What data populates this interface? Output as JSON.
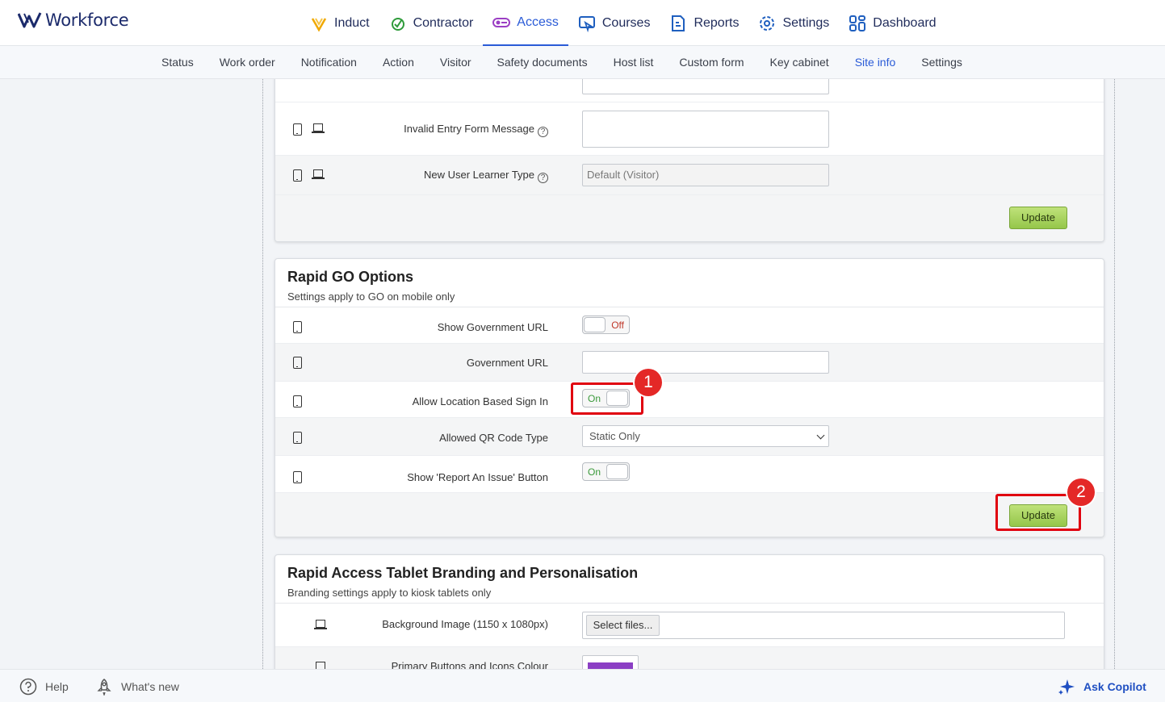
{
  "brand": {
    "name": "Workforce"
  },
  "top_nav": [
    {
      "label": "Induct",
      "icon": "induct-icon",
      "active": false
    },
    {
      "label": "Contractor",
      "icon": "contractor-icon",
      "active": false
    },
    {
      "label": "Access",
      "icon": "access-icon",
      "active": true
    },
    {
      "label": "Courses",
      "icon": "courses-icon",
      "active": false
    },
    {
      "label": "Reports",
      "icon": "reports-icon",
      "active": false
    },
    {
      "label": "Settings",
      "icon": "settings-icon",
      "active": false
    },
    {
      "label": "Dashboard",
      "icon": "dashboard-icon",
      "active": false
    }
  ],
  "sub_nav": [
    {
      "label": "Status"
    },
    {
      "label": "Work order"
    },
    {
      "label": "Notification"
    },
    {
      "label": "Action"
    },
    {
      "label": "Visitor"
    },
    {
      "label": "Safety documents"
    },
    {
      "label": "Host list"
    },
    {
      "label": "Custom form"
    },
    {
      "label": "Key cabinet"
    },
    {
      "label": "Site info",
      "active": true
    },
    {
      "label": "Settings"
    }
  ],
  "card1": {
    "rows": [
      {
        "label": "Invalid Entry Form Message",
        "value": ""
      },
      {
        "label": "New User Learner Type",
        "value": "Default (Visitor)"
      }
    ],
    "update_label": "Update"
  },
  "card2": {
    "title": "Rapid GO Options",
    "subtitle": "Settings apply to GO on mobile only",
    "rows": [
      {
        "label": "Show Government URL",
        "toggle": "Off"
      },
      {
        "label": "Government URL",
        "value": ""
      },
      {
        "label": "Allow Location Based Sign In",
        "toggle": "On"
      },
      {
        "label": "Allowed QR Code Type",
        "value": "Static Only"
      },
      {
        "label": "Show 'Report An Issue' Button",
        "toggle": "On"
      }
    ],
    "update_label": "Update"
  },
  "card3": {
    "title": "Rapid Access Tablet Branding and Personalisation",
    "subtitle": "Branding settings apply to kiosk tablets only",
    "rows": [
      {
        "label": "Background Image (1150 x 1080px)",
        "button": "Select files..."
      },
      {
        "label": "Primary Buttons and Icons Colour",
        "color": "#8b3fc4"
      }
    ]
  },
  "annotations": [
    "1",
    "2"
  ],
  "colors": {
    "accent": "#2a5bd7",
    "highlight": "#e0000f",
    "update_button": "#a8d45a"
  },
  "footer": {
    "help": "Help",
    "whats_new": "What's new",
    "copilot": "Ask Copilot"
  }
}
